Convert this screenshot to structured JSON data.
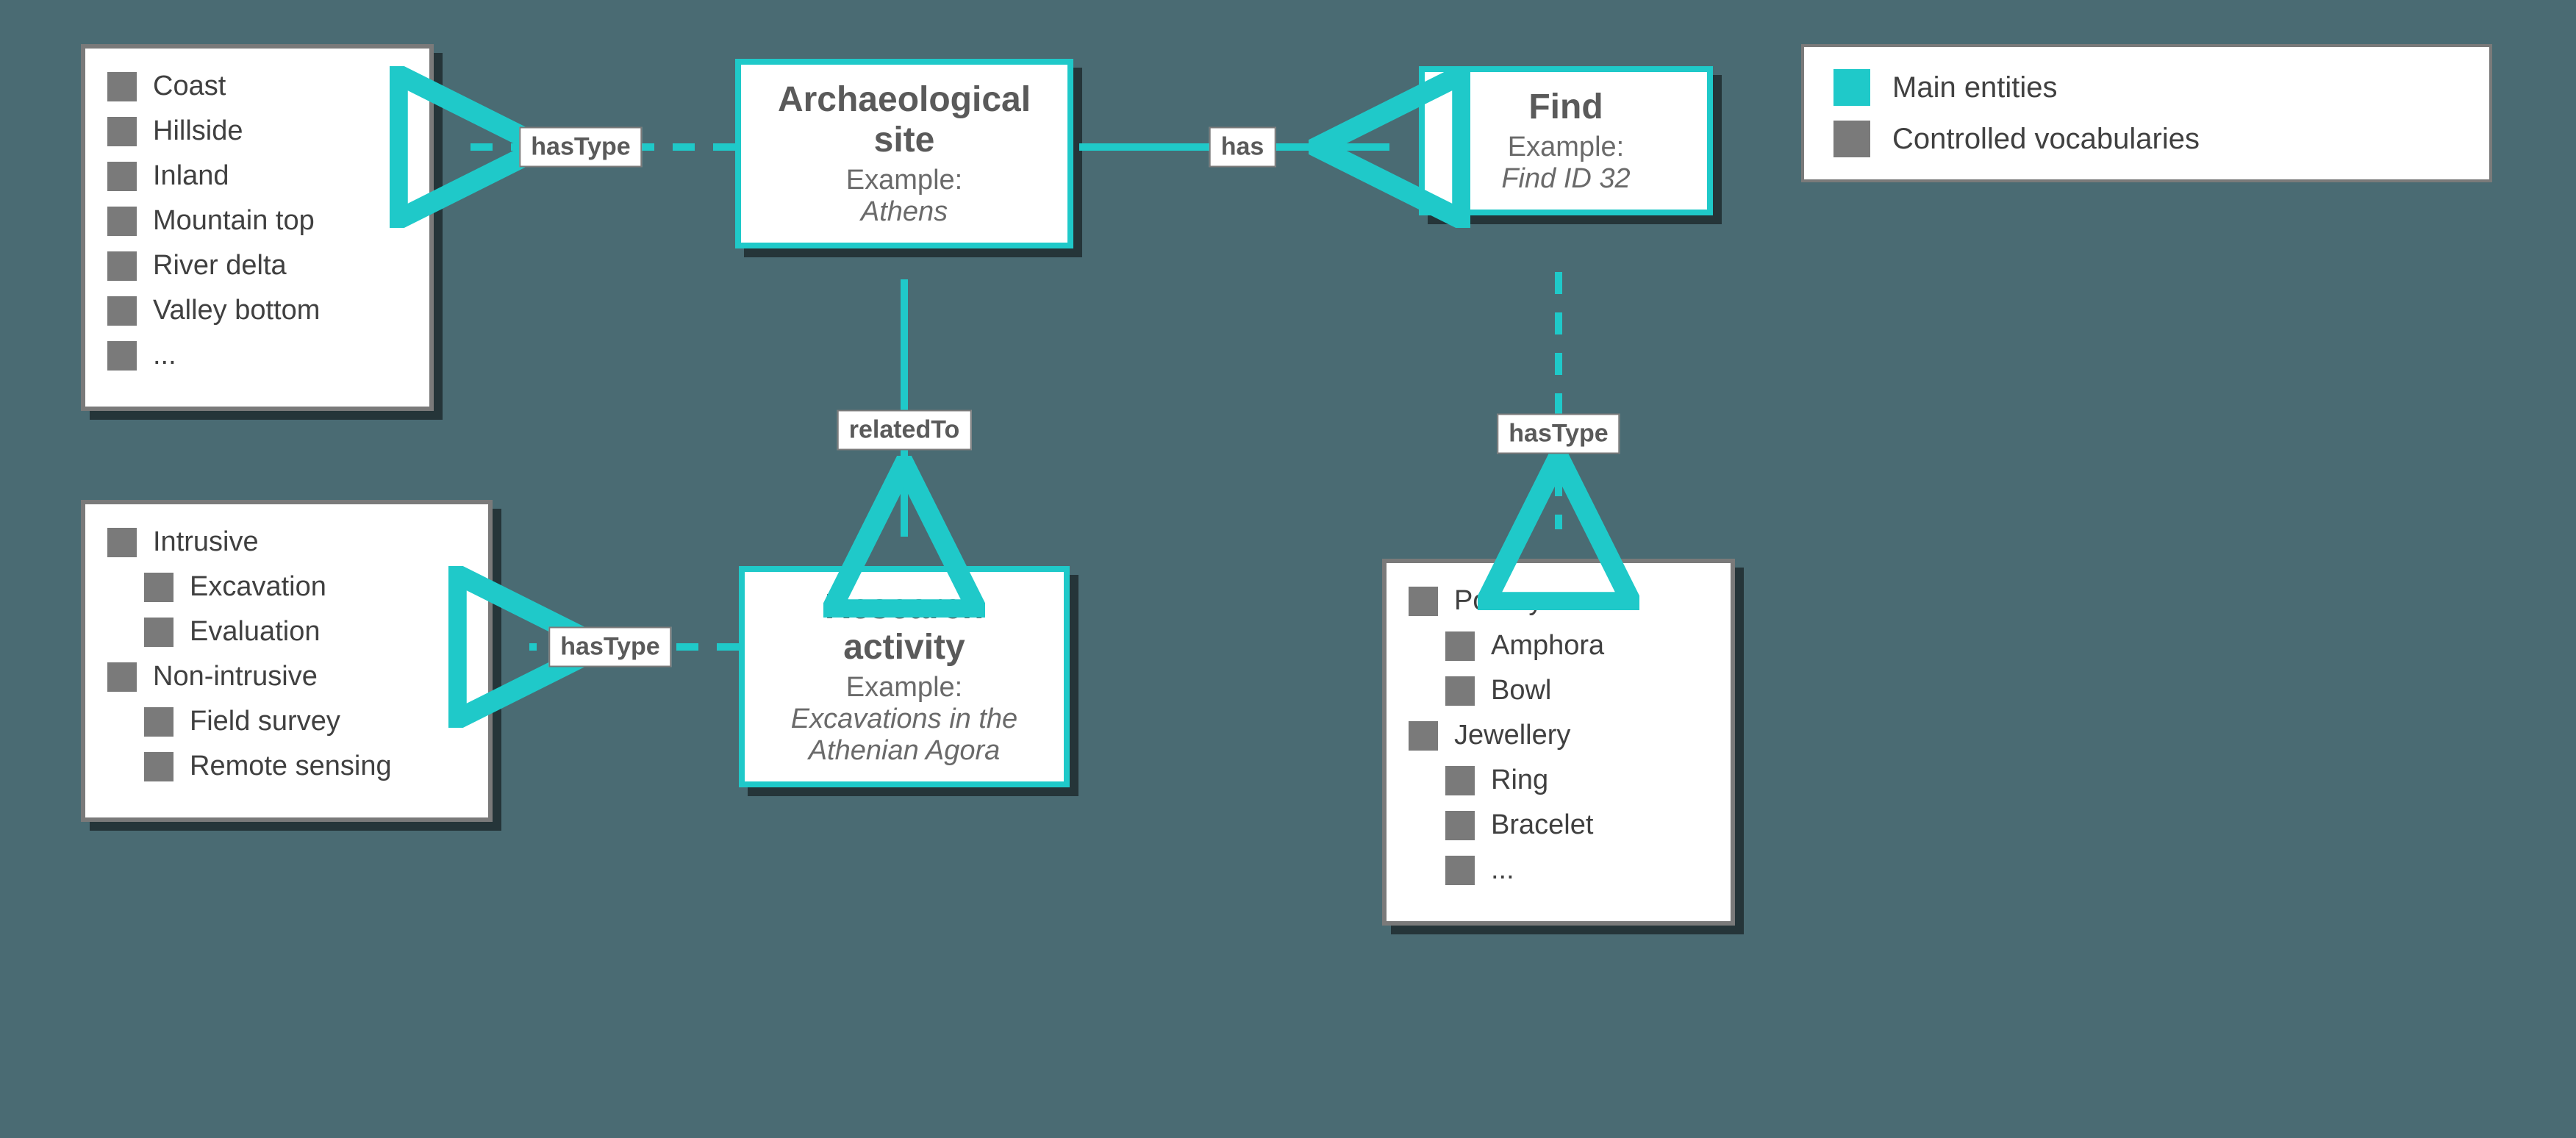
{
  "legend": {
    "main": "Main entities",
    "vocab": "Controlled vocabularies"
  },
  "entities": {
    "site": {
      "title1": "Archaeological",
      "title2": "site",
      "exampleLabel": "Example:",
      "example": "Athens"
    },
    "find": {
      "title": "Find",
      "exampleLabel": "Example:",
      "example": "Find ID 32"
    },
    "research": {
      "title1": "Research",
      "title2": "activity",
      "exampleLabel": "Example:",
      "example1": "Excavations in the",
      "example2": "Athenian Agora"
    }
  },
  "edges": {
    "siteHasType": "hasType",
    "siteHas": "has",
    "siteRelatedTo": "relatedTo",
    "researchHasType": "hasType",
    "findHasType": "hasType"
  },
  "vocab": {
    "siteTypes": {
      "items": [
        "Coast",
        "Hillside",
        "Inland",
        "Mountain top",
        "River delta",
        "Valley bottom",
        "..."
      ]
    },
    "researchTypes": {
      "groups": [
        {
          "label": "Intrusive",
          "children": [
            "Excavation",
            "Evaluation"
          ]
        },
        {
          "label": "Non-intrusive",
          "children": [
            "Field survey",
            "Remote sensing"
          ]
        }
      ]
    },
    "findTypes": {
      "groups": [
        {
          "label": "Pottery",
          "children": [
            "Amphora",
            "Bowl"
          ]
        },
        {
          "label": "Jewellery",
          "children": [
            "Ring",
            "Bracelet",
            "..."
          ]
        }
      ]
    }
  },
  "colors": {
    "entity": "#1fc9c9",
    "vocab": "#7a7a7a"
  }
}
